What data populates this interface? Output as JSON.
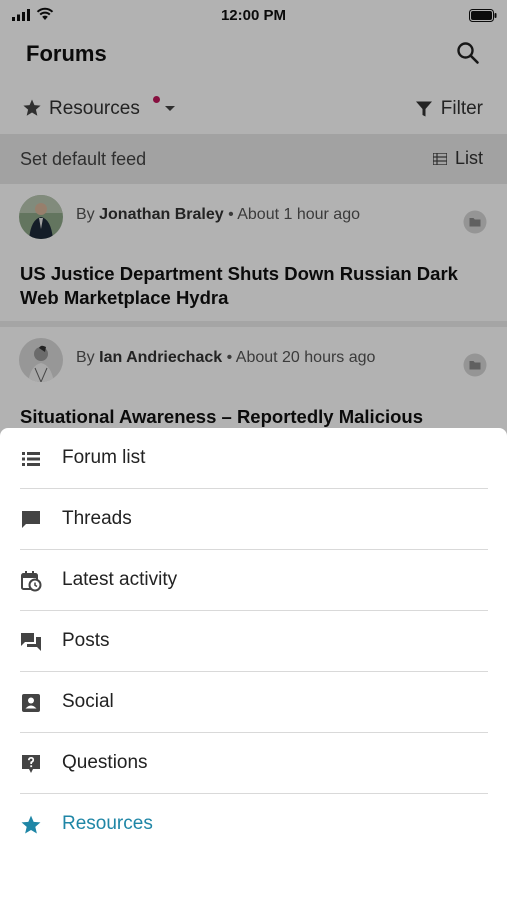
{
  "status_bar": {
    "time": "12:00 PM"
  },
  "header": {
    "title": "Forums"
  },
  "feed": {
    "selected": "Resources",
    "filter_label": "Filter"
  },
  "default_feed": {
    "label": "Set default feed",
    "view_label": "List"
  },
  "posts": [
    {
      "by_prefix": "By",
      "author": "Jonathan Braley",
      "time": "About 1 hour ago",
      "title": "US Justice Department Shuts Down Russian Dark Web Marketplace Hydra"
    },
    {
      "by_prefix": "By",
      "author": "Ian Andriechack",
      "time": "About 20 hours ago",
      "title": "Situational Awareness – Reportedly Malicious"
    }
  ],
  "menu": {
    "items": [
      {
        "label": "Forum list",
        "icon": "list-icon"
      },
      {
        "label": "Threads",
        "icon": "chat-bubble-icon"
      },
      {
        "label": "Latest activity",
        "icon": "calendar-clock-icon"
      },
      {
        "label": "Posts",
        "icon": "forum-icon"
      },
      {
        "label": "Social",
        "icon": "contact-card-icon"
      },
      {
        "label": "Questions",
        "icon": "question-bubble-icon"
      },
      {
        "label": "Resources",
        "icon": "star-icon",
        "active": true
      }
    ]
  },
  "colors": {
    "accent": "#1f86a6",
    "notification_dot": "#c2185b"
  }
}
